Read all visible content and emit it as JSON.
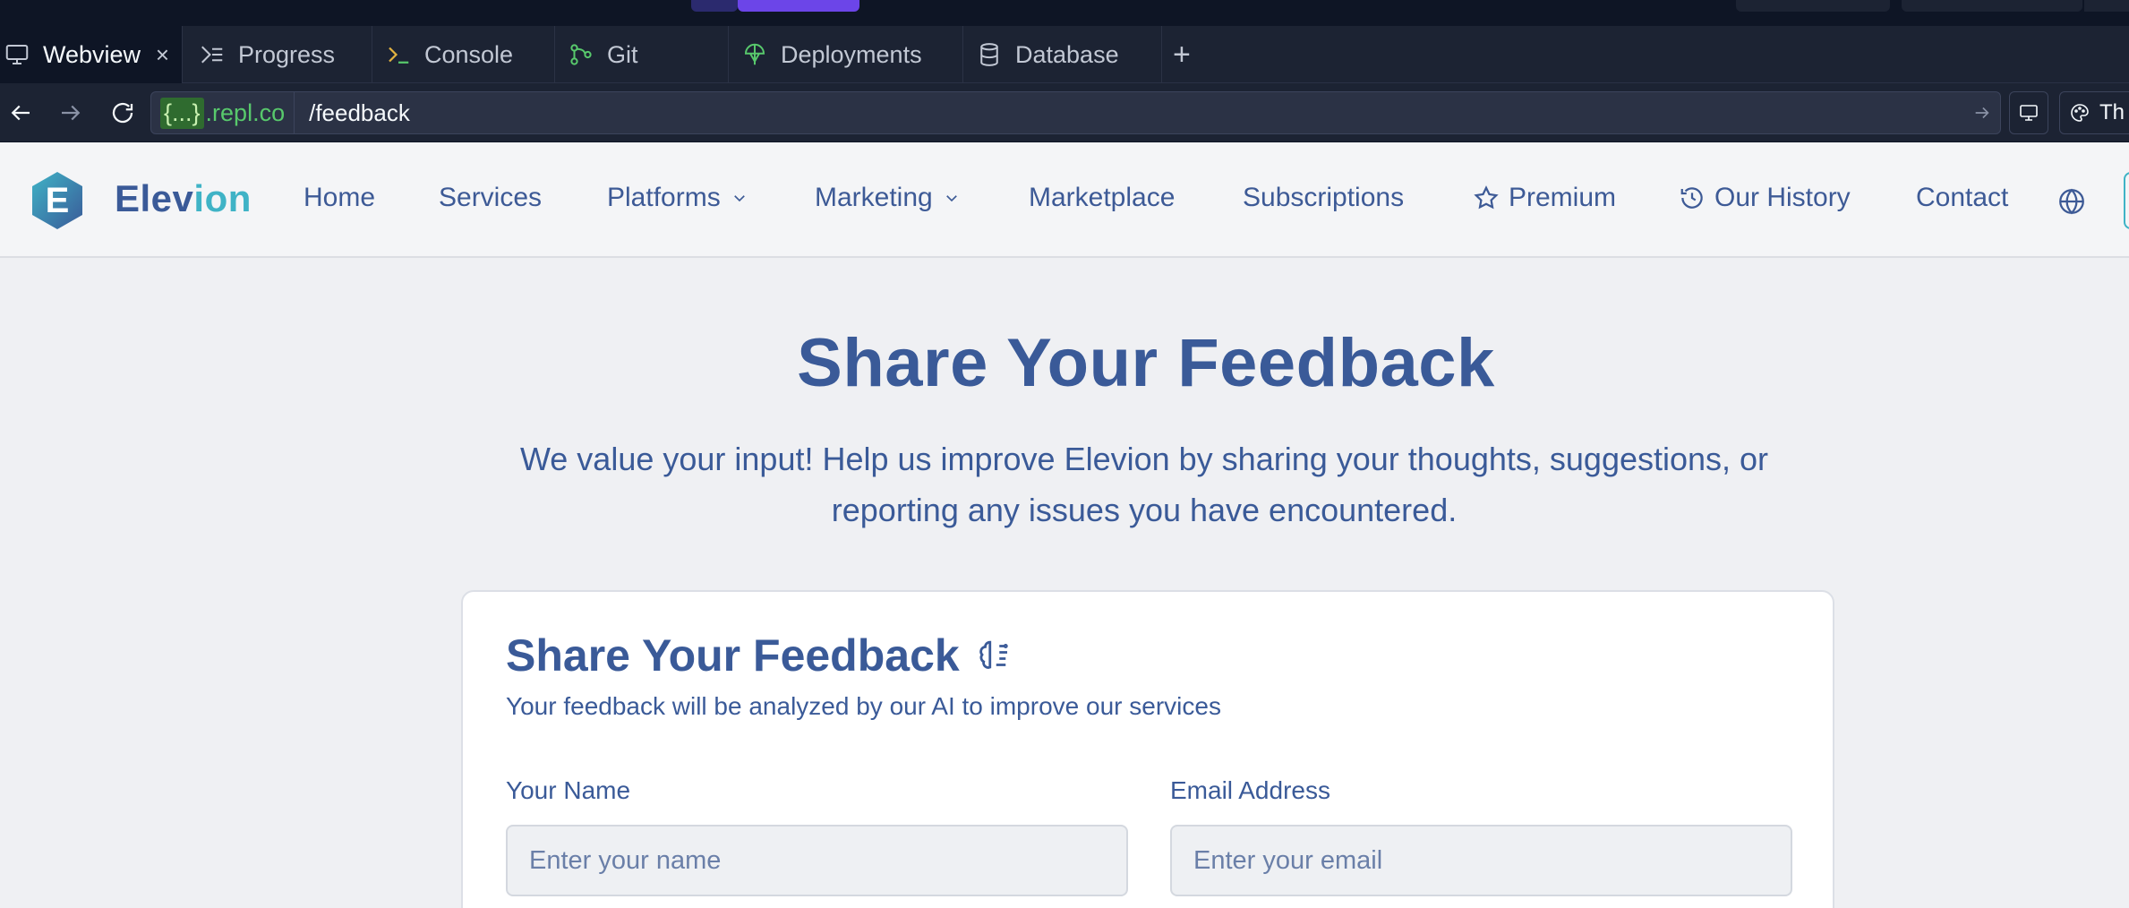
{
  "ide": {
    "tabs": [
      {
        "label": "Webview",
        "icon": "monitor-icon",
        "active": true
      },
      {
        "label": "Progress",
        "icon": "progress-icon"
      },
      {
        "label": "Console",
        "icon": "terminal-icon"
      },
      {
        "label": "Git",
        "icon": "git-icon"
      },
      {
        "label": "Deployments",
        "icon": "deployments-icon"
      },
      {
        "label": "Database",
        "icon": "database-icon"
      }
    ],
    "close_glyph": "×",
    "add_tab_glyph": "+",
    "address": {
      "origin_brace": "{...}",
      "origin_domain": ".repl.co",
      "path": "/feedback",
      "right_button_text": "Th"
    }
  },
  "site": {
    "brand": {
      "part1": "Elev",
      "part2": "ion",
      "logo_letter": "E"
    },
    "nav": {
      "home": "Home",
      "services": "Services",
      "platforms": "Platforms",
      "marketing": "Marketing",
      "marketplace": "Marketplace",
      "subscriptions": "Subscriptions",
      "premium": "Premium",
      "history": "Our History",
      "contact": "Contact"
    },
    "colors": {
      "primary": "#3a5a98",
      "accent": "#3fb3c6",
      "ide_bg": "#1c2333"
    }
  },
  "page": {
    "title": "Share Your Feedback",
    "subtitle": "We value your input! Help us improve Elevion by sharing your thoughts, suggestions, or reporting any issues you have encountered."
  },
  "form": {
    "title": "Share Your Feedback",
    "subtitle": "Your feedback will be analyzed by our AI to improve our services",
    "name_label": "Your Name",
    "name_placeholder": "Enter your name",
    "email_label": "Email Address",
    "email_placeholder": "Enter your email"
  }
}
